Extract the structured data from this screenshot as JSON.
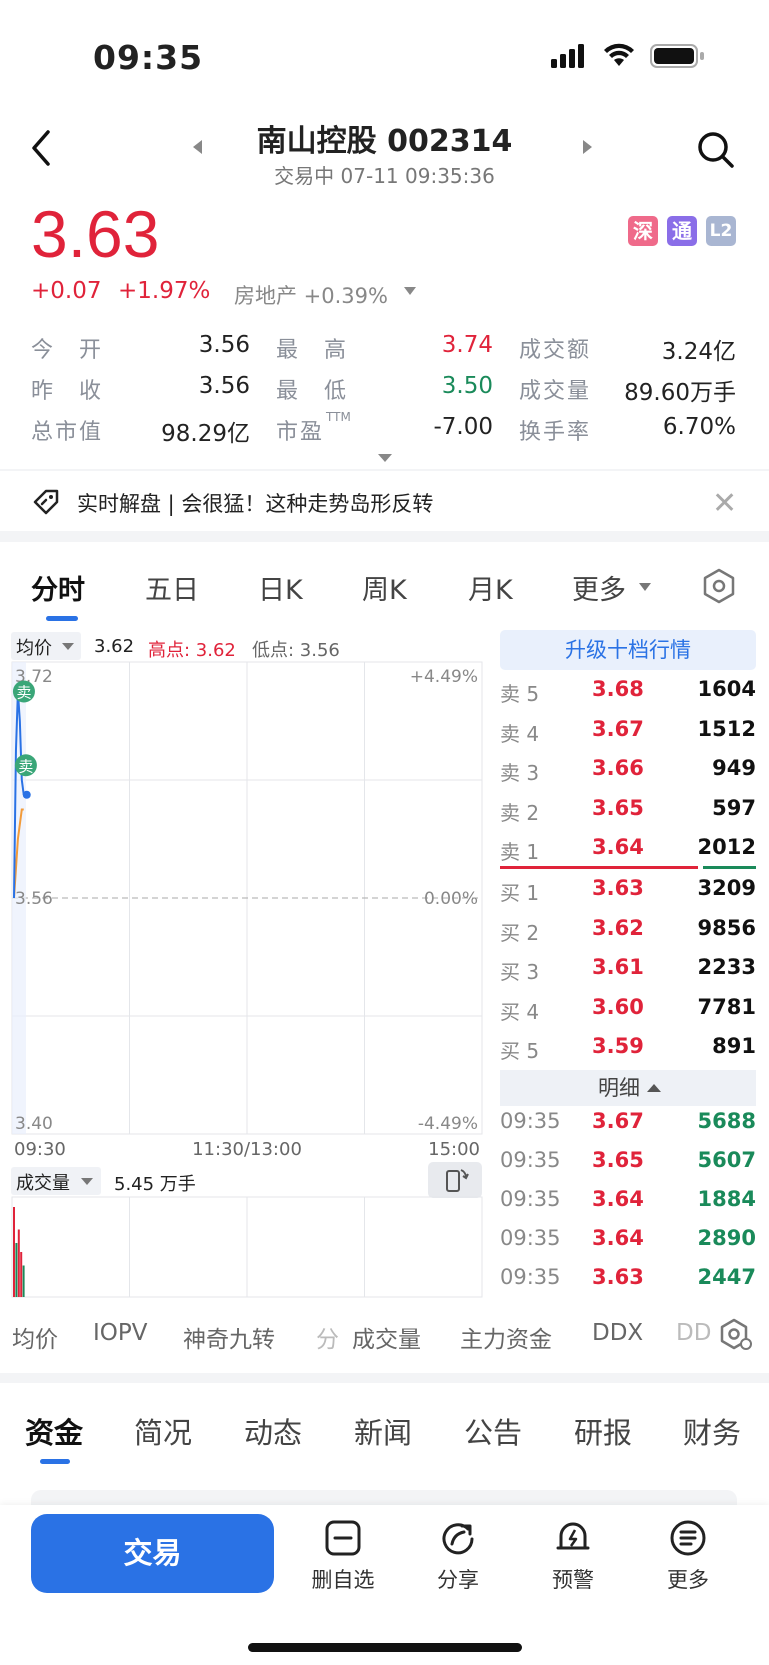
{
  "status_bar": {
    "time": "09:35"
  },
  "header": {
    "title": "南山控股 002314",
    "status": "交易中 07-11 09:35:36"
  },
  "price_block": {
    "price": "3.63",
    "change": "+0.07",
    "change_pct": "+1.97%",
    "sector": "房地产 +0.39%",
    "badges": [
      "深",
      "通",
      "L2"
    ]
  },
  "quote": {
    "open_label": "今　开",
    "open": "3.56",
    "high_label": "最　高",
    "high": "3.74",
    "amount_label": "成交额",
    "amount": "3.24亿",
    "prev_label": "昨　收",
    "prev": "3.56",
    "low_label": "最　低",
    "low": "3.50",
    "volume_label": "成交量",
    "volume": "89.60万手",
    "mktcap_label": "总市值",
    "mktcap": "98.29亿",
    "pe_label": "市盈",
    "pe_sup": "TTM",
    "pe": "-7.00",
    "turnover_label": "换手率",
    "turnover": "6.70%"
  },
  "news": {
    "text": "实时解盘 | 会很猛！这种走势岛形反转"
  },
  "chart_tabs": [
    "分时",
    "五日",
    "日K",
    "周K",
    "月K",
    "更多"
  ],
  "chart_header": {
    "avg_label": "均价",
    "avg_value": "3.62",
    "high_text": "高点: 3.62",
    "low_text": "低点: 3.56"
  },
  "chart_data": {
    "type": "line",
    "y_labels": {
      "top": "3.72",
      "mid": "3.56",
      "bottom": "3.40"
    },
    "pct_labels": {
      "top": "+4.49%",
      "mid": "0.00%",
      "bottom": "-4.49%"
    },
    "x_labels": [
      "09:30",
      "11:30/13:00",
      "15:00"
    ],
    "ylim": [
      3.4,
      3.72
    ],
    "base": 3.56,
    "minutes": [
      0,
      1,
      2,
      3,
      4,
      5
    ],
    "price": [
      3.56,
      3.66,
      3.7,
      3.68,
      3.64,
      3.63
    ],
    "avg": [
      3.56,
      3.58,
      3.6,
      3.61,
      3.62,
      3.62
    ],
    "sell_markers": [
      {
        "minute": 1,
        "value": 3.7,
        "label": "卖"
      },
      {
        "minute": 2,
        "value": 3.65,
        "label": "卖"
      }
    ],
    "volume_bars": [
      {
        "minute": 0,
        "value": 1.0,
        "color": "#e0233a"
      },
      {
        "minute": 1,
        "value": 0.6,
        "color": "#1a8a5a"
      },
      {
        "minute": 2,
        "value": 0.75,
        "color": "#e0233a"
      },
      {
        "minute": 3,
        "value": 0.5,
        "color": "#e0233a"
      },
      {
        "minute": 4,
        "value": 0.35,
        "color": "#1a8a5a"
      }
    ]
  },
  "order_book": {
    "upgrade_label": "升级十档行情",
    "asks": [
      {
        "label": "卖 5",
        "price": "3.68",
        "vol": "1604"
      },
      {
        "label": "卖 4",
        "price": "3.67",
        "vol": "1512"
      },
      {
        "label": "卖 3",
        "price": "3.66",
        "vol": "949"
      },
      {
        "label": "卖 2",
        "price": "3.65",
        "vol": "597"
      },
      {
        "label": "卖 1",
        "price": "3.64",
        "vol": "2012"
      }
    ],
    "bids": [
      {
        "label": "买 1",
        "price": "3.63",
        "vol": "3209"
      },
      {
        "label": "买 2",
        "price": "3.62",
        "vol": "9856"
      },
      {
        "label": "买 3",
        "price": "3.61",
        "vol": "2233"
      },
      {
        "label": "买 4",
        "price": "3.60",
        "vol": "7781"
      },
      {
        "label": "买 5",
        "price": "3.59",
        "vol": "891"
      }
    ],
    "detail_label": "明细",
    "ticks": [
      {
        "time": "09:35",
        "price": "3.67",
        "vol": "5688"
      },
      {
        "time": "09:35",
        "price": "3.65",
        "vol": "5607"
      },
      {
        "time": "09:35",
        "price": "3.64",
        "vol": "1884"
      },
      {
        "time": "09:35",
        "price": "3.64",
        "vol": "2890"
      },
      {
        "time": "09:35",
        "price": "3.63",
        "vol": "2447"
      }
    ]
  },
  "volume_header": {
    "label": "成交量",
    "value": "5.45 万手"
  },
  "indicator_tabs": [
    "均价",
    "IOPV",
    "神奇九转",
    "分",
    "成交量",
    "主力资金",
    "DDX",
    "DD"
  ],
  "info_tabs": [
    "资金",
    "简况",
    "动态",
    "新闻",
    "公告",
    "研报",
    "财务"
  ],
  "bottom_bar": {
    "trade_label": "交易",
    "actions": [
      "删自选",
      "分享",
      "预警",
      "更多"
    ]
  },
  "colors": {
    "red": "#e0233a",
    "green": "#1a8a5a",
    "blue": "#2a72e5"
  }
}
